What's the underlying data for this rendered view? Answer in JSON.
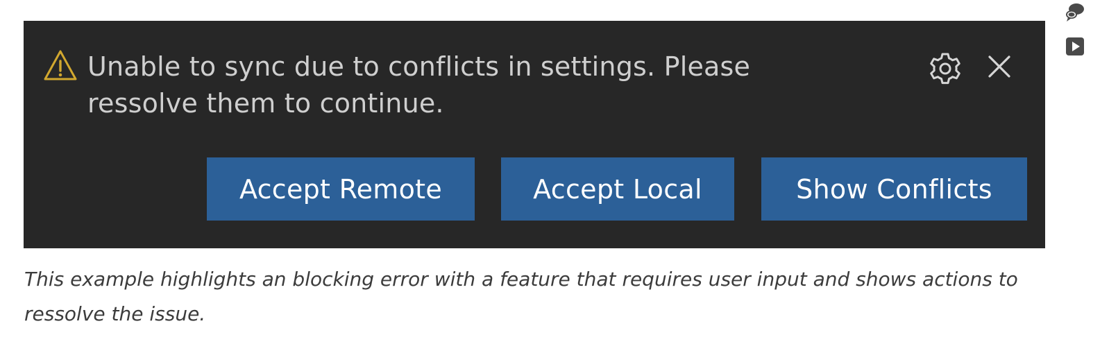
{
  "notification": {
    "message": "Unable to sync due to conflicts in settings. Please ressolve them to continue.",
    "icons": {
      "warning": "warning-icon",
      "settings": "gear-icon",
      "close": "close-icon"
    },
    "actions": [
      {
        "label": "Accept Remote"
      },
      {
        "label": "Accept Local"
      },
      {
        "label": "Show Conflicts"
      }
    ],
    "colors": {
      "background": "#272727",
      "text": "#cfcfcf",
      "warning": "#d2a82f",
      "button": "#2c6098",
      "button_text": "#ffffff"
    }
  },
  "caption": "This example highlights an blocking error with a feature that requires user input and shows actions to ressolve the issue.",
  "side_icons": [
    {
      "name": "feedback-icon"
    },
    {
      "name": "video-icon"
    }
  ]
}
